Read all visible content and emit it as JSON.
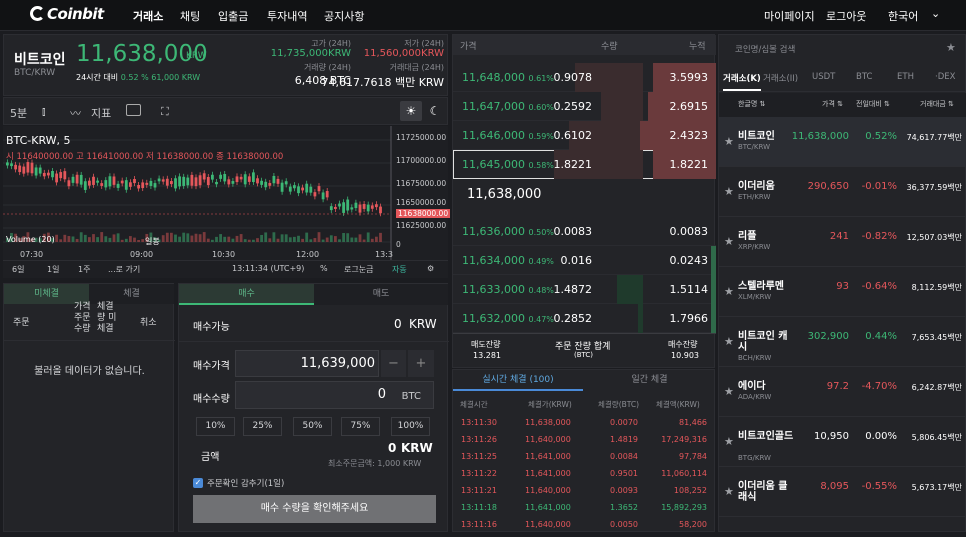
{
  "nav": {
    "logo": "Coinbit",
    "items": [
      "거래소",
      "채팅",
      "입출금",
      "투자내역",
      "공지사항"
    ],
    "right": [
      "마이페이지",
      "로그아웃",
      "한국어"
    ]
  },
  "ticker": {
    "name": "비트코인",
    "pair": "BTC/KRW",
    "price": "11,638,000",
    "unit": "KRW",
    "chg_label": "24시간 대비",
    "chg_pct": "0.52 %",
    "chg_abs": "61,000 KRW",
    "high_label": "고가 (24H)",
    "high": "11,735,000KRW",
    "low_label": "저가 (24H)",
    "low": "11,560,000KRW",
    "vol_label": "거래량 (24H)",
    "vol": "6,408 BTC",
    "amt_label": "거래대금 (24H)",
    "amt": "74,617.7618 백만 KRW"
  },
  "chart_toolbar": {
    "interval": "5분",
    "indicator": "지표"
  },
  "chart": {
    "title": "BTC-KRW, 5",
    "ohlc": "시 11640000.00 고 11641000.00 저 11638000.00 종 11638000.00",
    "volume_label": "Volume (20)",
    "yticks": [
      "11725000.00",
      "11700000.00",
      "11675000.00",
      "11650000.00",
      "11625000.00",
      "0"
    ],
    "last": "11638000.00",
    "xticks": [
      "07:30",
      "09:00",
      "10:30",
      "12:00",
      "13:3"
    ],
    "cursor": "일봉"
  },
  "chart_bottom": {
    "ranges": [
      "6일",
      "1일",
      "1주",
      "...로 가기"
    ],
    "time": "13:11:34 (UTC+9)",
    "pct": "%",
    "log": "로그눈금",
    "auto": "자동"
  },
  "order_tabs": [
    "미체결",
    "체결"
  ],
  "order_cols": [
    "주문",
    "가격 주문 수량",
    "체결량 미체결",
    "취소"
  ],
  "order_empty": "불러올 데이터가 없습니다.",
  "trade_tabs": [
    "매수",
    "매도"
  ],
  "trade": {
    "avail_label": "매수가능",
    "avail": "0",
    "avail_unit": "KRW",
    "price_label": "매수가격",
    "price": "11,639,000",
    "qty_label": "매수수량",
    "qty": "0",
    "qty_unit": "BTC",
    "pcts": [
      "10%",
      "25%",
      "50%",
      "75%",
      "100%"
    ],
    "total_label": "금액",
    "total": "0",
    "total_unit": "KRW",
    "min": "최소주문금액: 1,000 KRW",
    "confirm": "주문확인 감추기(1일)",
    "submit": "매수 수량을 확인해주세요"
  },
  "orderbook": {
    "cols": [
      "가격",
      "수량",
      "누적"
    ],
    "rows": [
      {
        "p": "11,648,000",
        "pct": "0.61%",
        "q": "0.9078",
        "t": "3.5993"
      },
      {
        "p": "11,647,000",
        "pct": "0.60%",
        "q": "0.2592",
        "t": "2.6915"
      },
      {
        "p": "11,646,000",
        "pct": "0.59%",
        "q": "0.6102",
        "t": "2.4323"
      },
      {
        "p": "11,645,000",
        "pct": "0.58%",
        "q": "1.8221",
        "t": "1.8221"
      }
    ],
    "mid": "11,638,000",
    "rows2": [
      {
        "p": "11,636,000",
        "pct": "0.50%",
        "q": "0.0083",
        "t": "0.0083"
      },
      {
        "p": "11,634,000",
        "pct": "0.49%",
        "q": "0.016",
        "t": "0.0243"
      },
      {
        "p": "11,633,000",
        "pct": "0.48%",
        "q": "1.4872",
        "t": "1.5114"
      },
      {
        "p": "11,632,000",
        "pct": "0.47%",
        "q": "0.2852",
        "t": "1.7966"
      }
    ],
    "sell_label": "매도잔량",
    "sell": "13.281",
    "sum_label": "주문 잔량 합계",
    "sum_sub": "(BTC)",
    "buy_label": "매수잔량",
    "buy": "10.903"
  },
  "trades": {
    "tabs": [
      "실시간 체결 (100)",
      "일간 체결"
    ],
    "cols": [
      "체결시간",
      "체결가(KRW)",
      "체결량(BTC)",
      "체결액(KRW)"
    ],
    "rows": [
      [
        "13:11:30",
        "11,638,000",
        "0.0070",
        "81,466",
        "r"
      ],
      [
        "13:11:26",
        "11,640,000",
        "1.4819",
        "17,249,316",
        "r"
      ],
      [
        "13:11:25",
        "11,641,000",
        "0.0084",
        "97,784",
        "r"
      ],
      [
        "13:11:22",
        "11,641,000",
        "0.9501",
        "11,060,114",
        "r"
      ],
      [
        "13:11:21",
        "11,640,000",
        "0.0093",
        "108,252",
        "r"
      ],
      [
        "13:11:18",
        "11,641,000",
        "1.3652",
        "15,892,293",
        "g"
      ],
      [
        "13:11:16",
        "11,640,000",
        "0.0050",
        "58,200",
        "r"
      ]
    ]
  },
  "market": {
    "search_placeholder": "코인명/심볼 검색",
    "tabs": [
      "거래소(K)",
      "거래소(II)",
      "USDT",
      "BTC",
      "ETH",
      "·DEX"
    ],
    "cols": [
      "한글명 ⇅",
      "가격 ⇅",
      "전일대비 ⇅",
      "거래대금 ⇅"
    ],
    "rows": [
      {
        "n": "비트코인",
        "s": "BTC/KRW",
        "p": "11,638,000",
        "c": "0.52%",
        "v": "74,617.77백만",
        "col": "g"
      },
      {
        "n": "이더리움",
        "s": "ETH/KRW",
        "p": "290,650",
        "c": "-0.01%",
        "v": "36,377.59백만",
        "col": "r"
      },
      {
        "n": "리플",
        "s": "XRP/KRW",
        "p": "241",
        "c": "-0.82%",
        "v": "12,507.03백만",
        "col": "r"
      },
      {
        "n": "스텔라루멘",
        "s": "XLM/KRW",
        "p": "93",
        "c": "-0.64%",
        "v": "8,112.59백만",
        "col": "r"
      },
      {
        "n": "비트코인 캐시",
        "s": "BCH/KRW",
        "p": "302,900",
        "c": "0.44%",
        "v": "7,653.45백만",
        "col": "g"
      },
      {
        "n": "에이다",
        "s": "ADA/KRW",
        "p": "97.2",
        "c": "-4.70%",
        "v": "6,242.87백만",
        "col": "r"
      },
      {
        "n": "비트코인골드",
        "s": "BTG/KRW",
        "p": "10,950",
        "c": "0.00%",
        "v": "5,806.45백만",
        "col": "w"
      },
      {
        "n": "이더리움 클래식",
        "s": "",
        "p": "8,095",
        "c": "-0.55%",
        "v": "5,673.17백만",
        "col": "r"
      }
    ]
  }
}
